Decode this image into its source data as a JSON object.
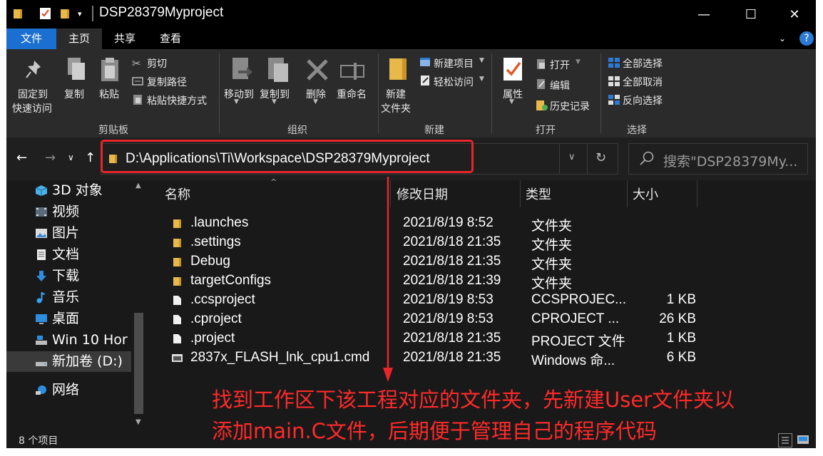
{
  "window": {
    "title": "DSP28379Myproject",
    "minimize": "—",
    "maximize": "☐",
    "close": "✕"
  },
  "tabs": [
    {
      "label": "文件"
    },
    {
      "label": "主页"
    },
    {
      "label": "共享"
    },
    {
      "label": "查看"
    }
  ],
  "help_label": "?",
  "ribbon": {
    "clipboard": {
      "pin_quick_access": "固定到",
      "pin_quick_access_2": "快速访问",
      "copy": "复制",
      "paste": "粘贴",
      "cut": "剪切",
      "copy_path": "复制路径",
      "paste_shortcut": "粘贴快捷方式",
      "group": "剪贴板"
    },
    "organize": {
      "move_to": "移动到",
      "copy_to": "复制到",
      "delete": "删除",
      "rename": "重命名",
      "group": "组织"
    },
    "new": {
      "new_folder": "新建",
      "new_folder_2": "文件夹",
      "new_item": "新建项目",
      "easy_access": "轻松访问",
      "group": "新建"
    },
    "open": {
      "properties": "属性",
      "open": "打开",
      "edit": "编辑",
      "history": "历史记录",
      "group": "打开"
    },
    "select": {
      "select_all": "全部选择",
      "select_none": "全部取消",
      "invert": "反向选择",
      "group": "选择"
    }
  },
  "address": {
    "path": "D:\\Applications\\Ti\\Workspace\\DSP28379Myproject",
    "search_placeholder": "搜索\"DSP28379My..."
  },
  "nav_pane": [
    {
      "label": "3D 对象",
      "icon": "3d-objects-icon"
    },
    {
      "label": "视频",
      "icon": "video-icon"
    },
    {
      "label": "图片",
      "icon": "pictures-icon"
    },
    {
      "label": "文档",
      "icon": "documents-icon"
    },
    {
      "label": "下载",
      "icon": "download-icon"
    },
    {
      "label": "音乐",
      "icon": "music-icon"
    },
    {
      "label": "桌面",
      "icon": "desktop-icon"
    },
    {
      "label": "Win 10 Hor",
      "icon": "drive-icon"
    },
    {
      "label": "新加卷 (D:)",
      "icon": "drive-icon",
      "selected": true
    },
    {
      "label": "网络",
      "icon": "network-icon"
    }
  ],
  "columns": {
    "name": "名称",
    "modified": "修改日期",
    "type": "类型",
    "size": "大小"
  },
  "files": [
    {
      "name": ".launches",
      "modified": "2021/8/19 8:52",
      "type": "文件夹",
      "size": "",
      "icon": "folder-icon"
    },
    {
      "name": ".settings",
      "modified": "2021/8/18 21:35",
      "type": "文件夹",
      "size": "",
      "icon": "folder-icon"
    },
    {
      "name": "Debug",
      "modified": "2021/8/18 21:35",
      "type": "文件夹",
      "size": "",
      "icon": "folder-icon"
    },
    {
      "name": "targetConfigs",
      "modified": "2021/8/18 21:39",
      "type": "文件夹",
      "size": "",
      "icon": "folder-icon"
    },
    {
      "name": ".ccsproject",
      "modified": "2021/8/19 8:53",
      "type": "CCSPROJEC...",
      "size": "1 KB",
      "icon": "file-icon"
    },
    {
      "name": ".cproject",
      "modified": "2021/8/19 8:53",
      "type": "CPROJECT ...",
      "size": "26 KB",
      "icon": "file-icon"
    },
    {
      "name": ".project",
      "modified": "2021/8/18 21:35",
      "type": "PROJECT 文件",
      "size": "1 KB",
      "icon": "file-icon"
    },
    {
      "name": "2837x_FLASH_lnk_cpu1.cmd",
      "modified": "2021/8/18 21:35",
      "type": "Windows 命...",
      "size": "6 KB",
      "icon": "cmd-file-icon"
    }
  ],
  "status": {
    "count": "8 个项目"
  },
  "annotation": {
    "line1": "找到工作区下该工程对应的文件夹，先新建User文件夹以",
    "line2": "添加main.C文件，后期便于管理自己的程序代码",
    "color": "#e8262a"
  }
}
